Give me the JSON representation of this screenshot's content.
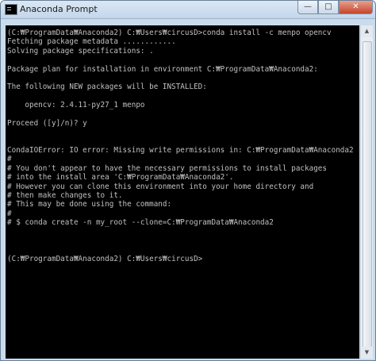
{
  "window": {
    "title": "Anaconda Prompt",
    "controls": {
      "minimize": "—",
      "maximize": "□",
      "close": "✕"
    }
  },
  "console": {
    "lines": [
      "(C:₩ProgramData₩Anaconda2) C:₩Users₩circusD>conda install -c menpo opencv",
      "Fetching package metadata ............",
      "Solving package specifications: .",
      "",
      "Package plan for installation in environment C:₩ProgramData₩Anaconda2:",
      "",
      "The following NEW packages will be INSTALLED:",
      "",
      "    opencv: 2.4.11-py27_1 menpo",
      "",
      "Proceed ([y]/n)? y",
      "",
      "",
      "CondaIOError: IO error: Missing write permissions in: C:₩ProgramData₩Anaconda2",
      "#",
      "# You don't appear to have the necessary permissions to install packages",
      "# into the install area 'C:₩ProgramData₩Anaconda2'.",
      "# However you can clone this environment into your home directory and",
      "# then make changes to it.",
      "# This may be done using the command:",
      "#",
      "# $ conda create -n my_root --clone=C:₩ProgramData₩Anaconda2",
      "",
      "",
      "",
      "(C:₩ProgramData₩Anaconda2) C:₩Users₩circusD>"
    ]
  },
  "scrollbar": {
    "up_arrow": "▲",
    "down_arrow": "▼"
  }
}
